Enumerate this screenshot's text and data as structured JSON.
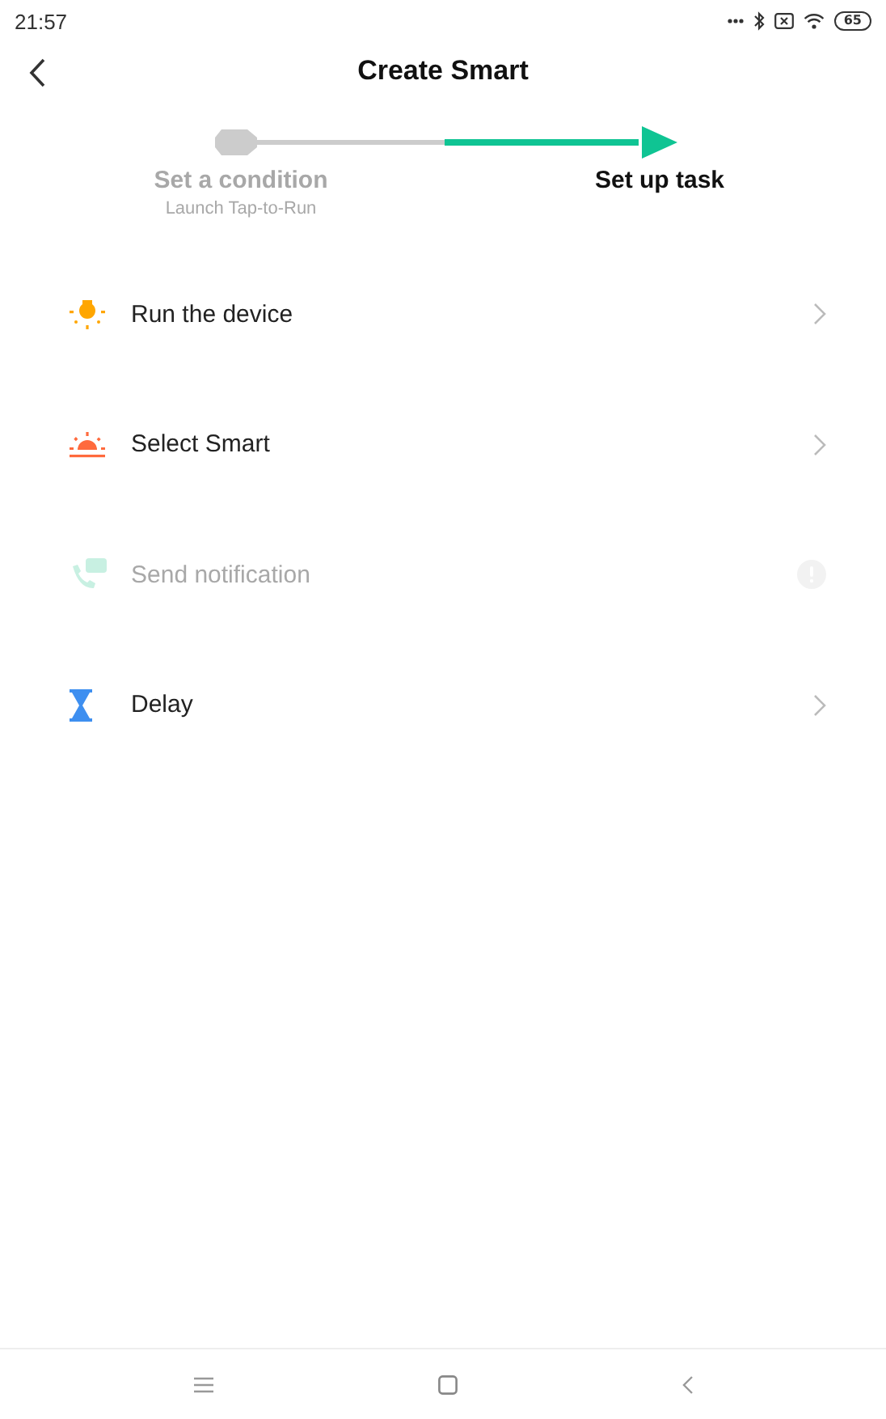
{
  "status_bar": {
    "time": "21:57",
    "battery": "65"
  },
  "header": {
    "title": "Create Smart"
  },
  "steps": [
    {
      "label": "Set a condition",
      "sublabel": "Launch Tap-to-Run",
      "selected": false
    },
    {
      "label": "Set up task",
      "selected": true
    }
  ],
  "actions": [
    {
      "kind": "device",
      "label": "Run the device",
      "disabled": false
    },
    {
      "kind": "smart",
      "label": "Select Smart",
      "disabled": false
    },
    {
      "kind": "notification",
      "label": "Send notification",
      "disabled": true
    },
    {
      "kind": "delay",
      "label": "Delay",
      "disabled": false
    }
  ]
}
